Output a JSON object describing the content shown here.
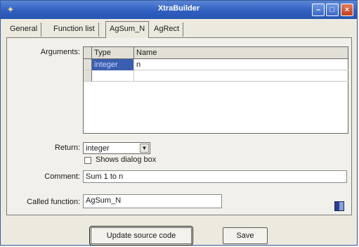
{
  "window": {
    "title": "XtraBuilder"
  },
  "tabs": [
    "General",
    "Function list",
    "AgSum_N",
    "AgRect"
  ],
  "form": {
    "arguments_label": "Arguments:",
    "columns": [
      "Type",
      "Name"
    ],
    "rows": [
      {
        "type": "integer",
        "name": "n"
      },
      {
        "type": "",
        "name": ""
      }
    ],
    "return_label": "Return:",
    "return_value": "integer",
    "shows_dialog_label": "Shows dialog box",
    "shows_dialog_checked": false,
    "comment_label": "Comment:",
    "comment_value": "Sum 1 to n",
    "called_function_label": "Called function:",
    "called_function_value": "AgSum_N"
  },
  "buttons": {
    "update": "Update source code",
    "save": "Save"
  },
  "colors": {
    "titlebar": "#2f5fbf",
    "selection": "#3b5eb0"
  }
}
